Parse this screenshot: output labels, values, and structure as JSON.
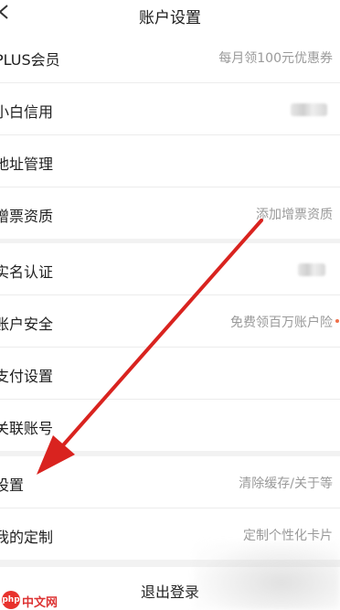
{
  "header": {
    "title": "账户设置"
  },
  "groups": [
    [
      {
        "label": "PLUS会员",
        "value": "每月领100元优惠券"
      },
      {
        "label": "小白信用",
        "value": ""
      },
      {
        "label": "地址管理",
        "value": ""
      },
      {
        "label": "增票资质",
        "value": "添加增票资质"
      }
    ],
    [
      {
        "label": "实名认证",
        "value": ""
      },
      {
        "label": "账户安全",
        "value": "免费领百万账户险"
      },
      {
        "label": "支付设置",
        "value": ""
      },
      {
        "label": "关联账号",
        "value": ""
      }
    ],
    [
      {
        "label": "设置",
        "value": "清除缓存/关于等"
      },
      {
        "label": "我的定制",
        "value": "定制个性化卡片"
      }
    ]
  ],
  "logout": {
    "label": "退出登录"
  },
  "watermark": {
    "logo": "php",
    "text": "中文网"
  },
  "colors": {
    "arrow": "#d9231f",
    "background": "#f2f2f2",
    "value_text": "#9a9a9a"
  }
}
